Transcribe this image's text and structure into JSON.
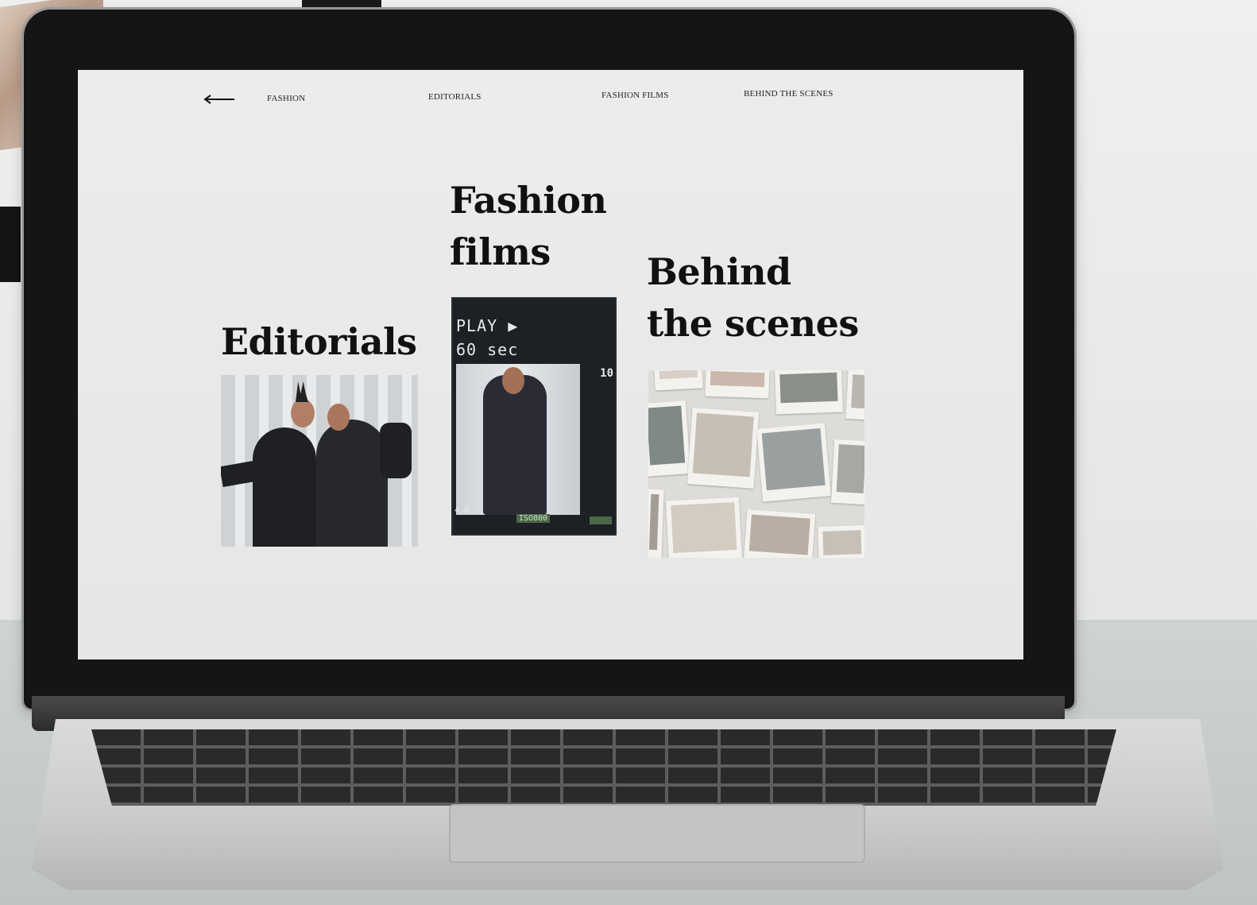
{
  "nav": {
    "back_icon": "arrow-left-icon",
    "items": [
      {
        "label": "FASHION"
      },
      {
        "label": "EDITORIALS"
      },
      {
        "label": "FASHION FILMS"
      },
      {
        "label": "BEHIND THE SCENES"
      }
    ]
  },
  "sections": {
    "fashion_films": {
      "title_line1": "Fashion",
      "title_line2": "films",
      "overlay": {
        "play": "PLAY ▶",
        "duration": "60 sec",
        "counter": "10",
        "fv": "4.0",
        "iso": "ISO800"
      }
    },
    "editorials": {
      "title": "Editorials"
    },
    "behind_the_scenes": {
      "title_line1": "Behind",
      "title_line2": "the scenes"
    }
  },
  "colors": {
    "screen_bg": "#e9e9e9",
    "text": "#111111",
    "bezel": "#151515"
  }
}
